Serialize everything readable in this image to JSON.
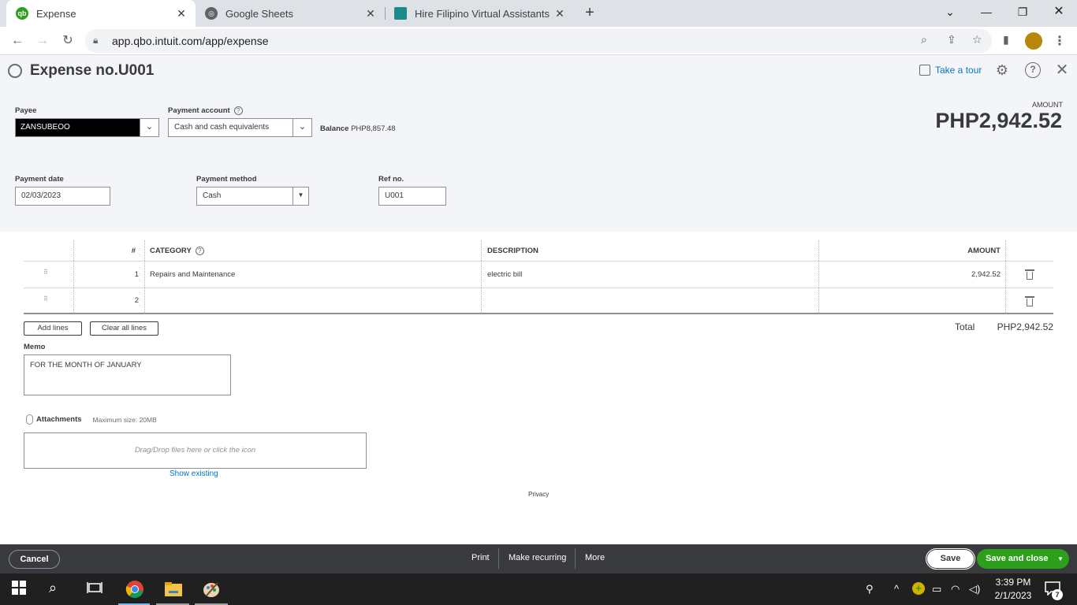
{
  "browser": {
    "tabs": [
      {
        "title": "Expense",
        "favicon": "qb-icon"
      },
      {
        "title": "Google Sheets",
        "favicon": "globe-icon"
      },
      {
        "title": "Hire Filipino Virtual Assistants | Fil",
        "favicon": "site-icon"
      }
    ],
    "url": "app.qbo.intuit.com/app/expense"
  },
  "header": {
    "title": "Expense no.U001",
    "tour": "Take a tour"
  },
  "form": {
    "payee_label": "Payee",
    "payee_value": "ZANSUBEOO",
    "payment_account_label": "Payment account",
    "payment_account_value": "Cash and cash equivalents",
    "balance_label": "Balance",
    "balance_value": "PHP8,857.48",
    "amount_label": "AMOUNT",
    "amount_value": "PHP2,942.52",
    "payment_date_label": "Payment date",
    "payment_date_value": "02/03/2023",
    "payment_method_label": "Payment method",
    "payment_method_value": "Cash",
    "ref_label": "Ref no.",
    "ref_value": "U001"
  },
  "table": {
    "headers": {
      "num": "#",
      "category": "CATEGORY",
      "description": "DESCRIPTION",
      "amount": "AMOUNT"
    },
    "rows": [
      {
        "num": "1",
        "category": "Repairs and Maintenance",
        "description": "electric bill",
        "amount": "2,942.52"
      },
      {
        "num": "2",
        "category": "",
        "description": "",
        "amount": ""
      }
    ]
  },
  "actions": {
    "add_lines": "Add lines",
    "clear_lines": "Clear all lines",
    "total_label": "Total",
    "total_value": "PHP2,942.52"
  },
  "memo": {
    "label": "Memo",
    "value": "FOR THE MONTH OF JANUARY"
  },
  "attachments": {
    "label": "Attachments",
    "max_size": "Maximum size: 20MB",
    "drop_text": "Drag/Drop files here or click the icon",
    "show_existing": "Show existing"
  },
  "privacy": "Privacy",
  "footer": {
    "cancel": "Cancel",
    "print": "Print",
    "make_recurring": "Make recurring",
    "more": "More",
    "save": "Save",
    "save_close": "Save and close"
  },
  "taskbar": {
    "time": "3:39 PM",
    "date": "2/1/2023",
    "notifications": "7"
  }
}
